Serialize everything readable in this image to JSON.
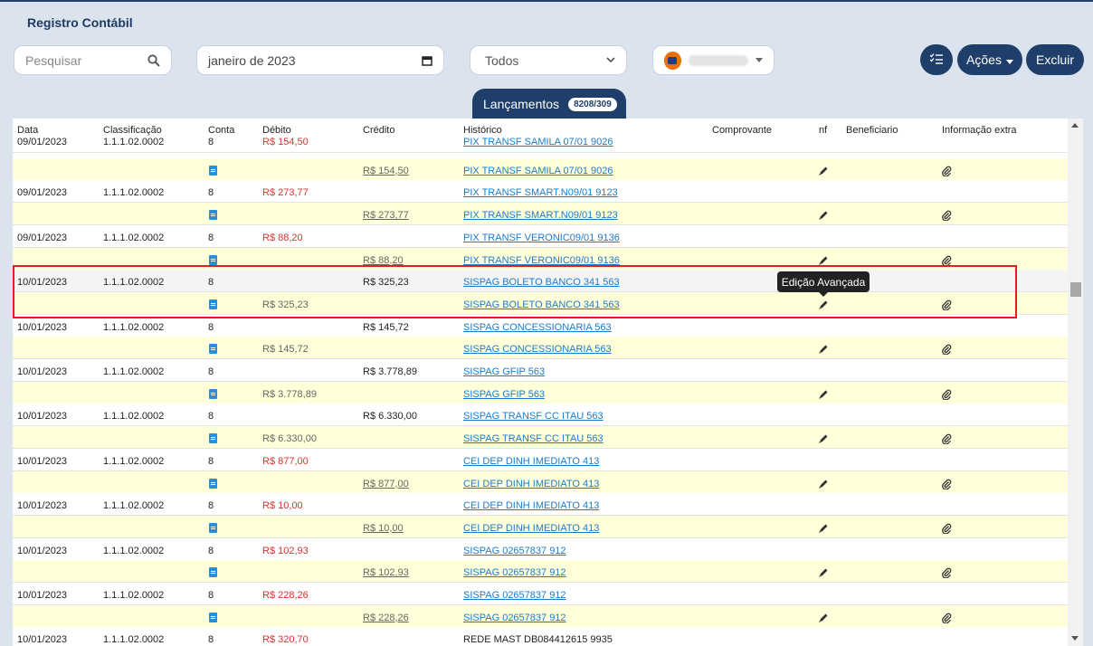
{
  "page": {
    "title": "Registro Contábil"
  },
  "search": {
    "placeholder": "Pesquisar"
  },
  "date_picker": {
    "value": "janeiro de 2023"
  },
  "filter_select": {
    "value": "Todos"
  },
  "account_select": {
    "bank_icon": "itau-bank-icon"
  },
  "actions": {
    "list_label": "",
    "acoes_label": "Ações",
    "excluir_label": "Excluir"
  },
  "tab": {
    "label": "Lançamentos",
    "badge": "8208/309"
  },
  "table": {
    "headers": {
      "data": "Data",
      "classificacao": "Classificação",
      "conta": "Conta",
      "debito": "Débito",
      "credito": "Crédito",
      "historico": "Histórico",
      "comprovante": "Comprovante",
      "nf": "nf",
      "beneficiario": "Beneficiario",
      "info": "Informação extra"
    },
    "rows": [
      {
        "kind": "main",
        "date": "09/01/2023",
        "class": "1.1.1.02.0002",
        "conta": "8",
        "debito": "R$ 154,50",
        "credito": "",
        "historico": "PIX TRANSF SAMILA 07/01 9026"
      },
      {
        "kind": "sub",
        "debito": "",
        "credito": "R$ 154,50",
        "historico": "PIX TRANSF SAMILA 07/01 9026"
      },
      {
        "kind": "main",
        "date": "09/01/2023",
        "class": "1.1.1.02.0002",
        "conta": "8",
        "debito": "R$ 273,77",
        "credito": "",
        "historico": "PIX TRANSF SMART.N09/01 9123"
      },
      {
        "kind": "sub",
        "debito": "",
        "credito": "R$ 273,77",
        "historico": "PIX TRANSF SMART.N09/01 9123"
      },
      {
        "kind": "main",
        "date": "09/01/2023",
        "class": "1.1.1.02.0002",
        "conta": "8",
        "debito": "R$ 88,20",
        "credito": "",
        "historico": "PIX TRANSF VERONIC09/01 9136"
      },
      {
        "kind": "sub",
        "debito": "",
        "credito": "R$ 88,20",
        "historico": "PIX TRANSF VERONIC09/01 9136"
      },
      {
        "kind": "main",
        "date": "10/01/2023",
        "class": "1.1.1.02.0002",
        "conta": "8",
        "debito": "",
        "credito": "R$ 325,23",
        "historico": "SISPAG BOLETO BANCO 341 563"
      },
      {
        "kind": "sub",
        "debito": "R$ 325,23",
        "credito": "",
        "historico": "SISPAG BOLETO BANCO 341 563"
      },
      {
        "kind": "main",
        "date": "10/01/2023",
        "class": "1.1.1.02.0002",
        "conta": "8",
        "debito": "",
        "credito": "R$ 145,72",
        "historico": "SISPAG CONCESSIONARIA 563"
      },
      {
        "kind": "sub",
        "debito": "R$ 145,72",
        "credito": "",
        "historico": "SISPAG CONCESSIONARIA 563"
      },
      {
        "kind": "main",
        "date": "10/01/2023",
        "class": "1.1.1.02.0002",
        "conta": "8",
        "debito": "",
        "credito": "R$ 3.778,89",
        "historico": "SISPAG GFIP 563"
      },
      {
        "kind": "sub",
        "debito": "R$ 3.778,89",
        "credito": "",
        "historico": "SISPAG GFIP 563"
      },
      {
        "kind": "main",
        "date": "10/01/2023",
        "class": "1.1.1.02.0002",
        "conta": "8",
        "debito": "",
        "credito": "R$ 6.330,00",
        "historico": "SISPAG TRANSF CC ITAU 563"
      },
      {
        "kind": "sub",
        "debito": "R$ 6.330,00",
        "credito": "",
        "historico": "SISPAG TRANSF CC ITAU 563"
      },
      {
        "kind": "main",
        "date": "10/01/2023",
        "class": "1.1.1.02.0002",
        "conta": "8",
        "debito": "R$ 877,00",
        "credito": "",
        "historico": "CEI DEP DINH IMEDIATO 413"
      },
      {
        "kind": "sub",
        "debito": "",
        "credito": "R$ 877,00",
        "historico": "CEI DEP DINH IMEDIATO 413"
      },
      {
        "kind": "main",
        "date": "10/01/2023",
        "class": "1.1.1.02.0002",
        "conta": "8",
        "debito": "R$ 10,00",
        "credito": "",
        "historico": "CEI DEP DINH IMEDIATO 413"
      },
      {
        "kind": "sub",
        "debito": "",
        "credito": "R$ 10,00",
        "historico": "CEI DEP DINH IMEDIATO 413"
      },
      {
        "kind": "main",
        "date": "10/01/2023",
        "class": "1.1.1.02.0002",
        "conta": "8",
        "debito": "R$ 102,93",
        "credito": "",
        "historico": "SISPAG 02657837 912"
      },
      {
        "kind": "sub",
        "debito": "",
        "credito": "R$ 102,93",
        "historico": "SISPAG 02657837 912"
      },
      {
        "kind": "main",
        "date": "10/01/2023",
        "class": "1.1.1.02.0002",
        "conta": "8",
        "debito": "R$ 228,26",
        "credito": "",
        "historico": "SISPAG 02657837 912"
      },
      {
        "kind": "sub",
        "debito": "",
        "credito": "R$ 228,26",
        "historico": "SISPAG 02657837 912"
      },
      {
        "kind": "main",
        "date": "10/01/2023",
        "class": "1.1.1.02.0002",
        "conta": "8",
        "debito": "R$ 320,70",
        "credito": "",
        "historico": "REDE MAST DB084412615 9935"
      }
    ]
  },
  "tooltip": {
    "text": "Edição Avançada"
  },
  "colors": {
    "primary": "#1f3f6a",
    "debit_red": "#e0312e",
    "link_blue": "#1d7bc9",
    "row_yellow": "#ffffd9",
    "highlight_red": "#e02020"
  }
}
